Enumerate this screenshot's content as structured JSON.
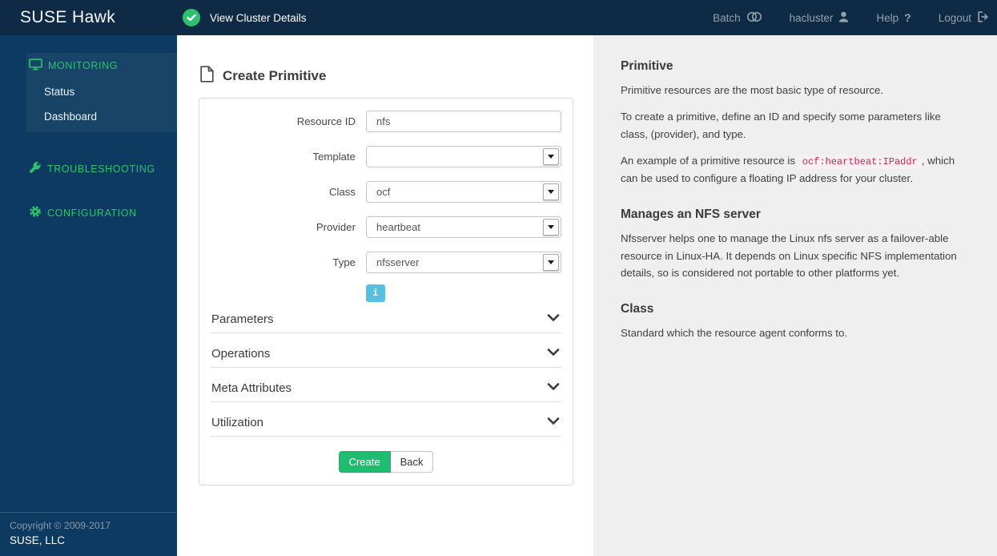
{
  "topbar": {
    "brand": "SUSE Hawk",
    "cluster_link": "View Cluster Details",
    "batch_label": "Batch",
    "user_label": "hacluster",
    "help_label": "Help",
    "help_glyph": "?",
    "logout_label": "Logout"
  },
  "sidebar": {
    "monitoring_label": "MONITORING",
    "status_label": "Status",
    "dashboard_label": "Dashboard",
    "troubleshooting_label": "TROUBLESHOOTING",
    "configuration_label": "CONFIGURATION"
  },
  "footer": {
    "copyright": "Copyright © 2009-2017",
    "company": "SUSE, LLC"
  },
  "form": {
    "title": "Create Primitive",
    "fields": {
      "resource_id": {
        "label": "Resource ID",
        "value": "nfs"
      },
      "template": {
        "label": "Template",
        "value": ""
      },
      "class": {
        "label": "Class",
        "value": "ocf"
      },
      "provider": {
        "label": "Provider",
        "value": "heartbeat"
      },
      "type": {
        "label": "Type",
        "value": "nfsserver"
      }
    },
    "info_button_glyph": "i",
    "accordions": [
      "Parameters",
      "Operations",
      "Meta Attributes",
      "Utilization"
    ],
    "create_label": "Create",
    "back_label": "Back"
  },
  "help": {
    "sections": [
      {
        "heading": "Primitive",
        "p1": "Primitive resources are the most basic type of resource.",
        "p2": "To create a primitive, define an ID and specify some parameters like class, (provider), and type.",
        "p3_before": "An example of a primitive resource is ",
        "p3_code": "ocf:heartbeat:IPaddr",
        "p3_after": ", which can be used to configure a floating IP address for your cluster."
      },
      {
        "heading": "Manages an NFS server",
        "body": "Nfsserver helps one to manage the Linux nfs server as a failover-able resource in Linux-HA. It depends on Linux specific NFS implementation details, so is considered not portable to other platforms yet."
      },
      {
        "heading": "Class",
        "body": "Standard which the resource agent conforms to."
      }
    ]
  },
  "colors": {
    "topbar_bg": "#0e2a44",
    "sidebar_bg": "#0c3a60",
    "accent_green": "#2ec16e",
    "create_button_green": "#1fbd6f",
    "info_blue": "#57c0e0",
    "code_red": "#c7254e",
    "help_panel_bg": "#efefef"
  }
}
